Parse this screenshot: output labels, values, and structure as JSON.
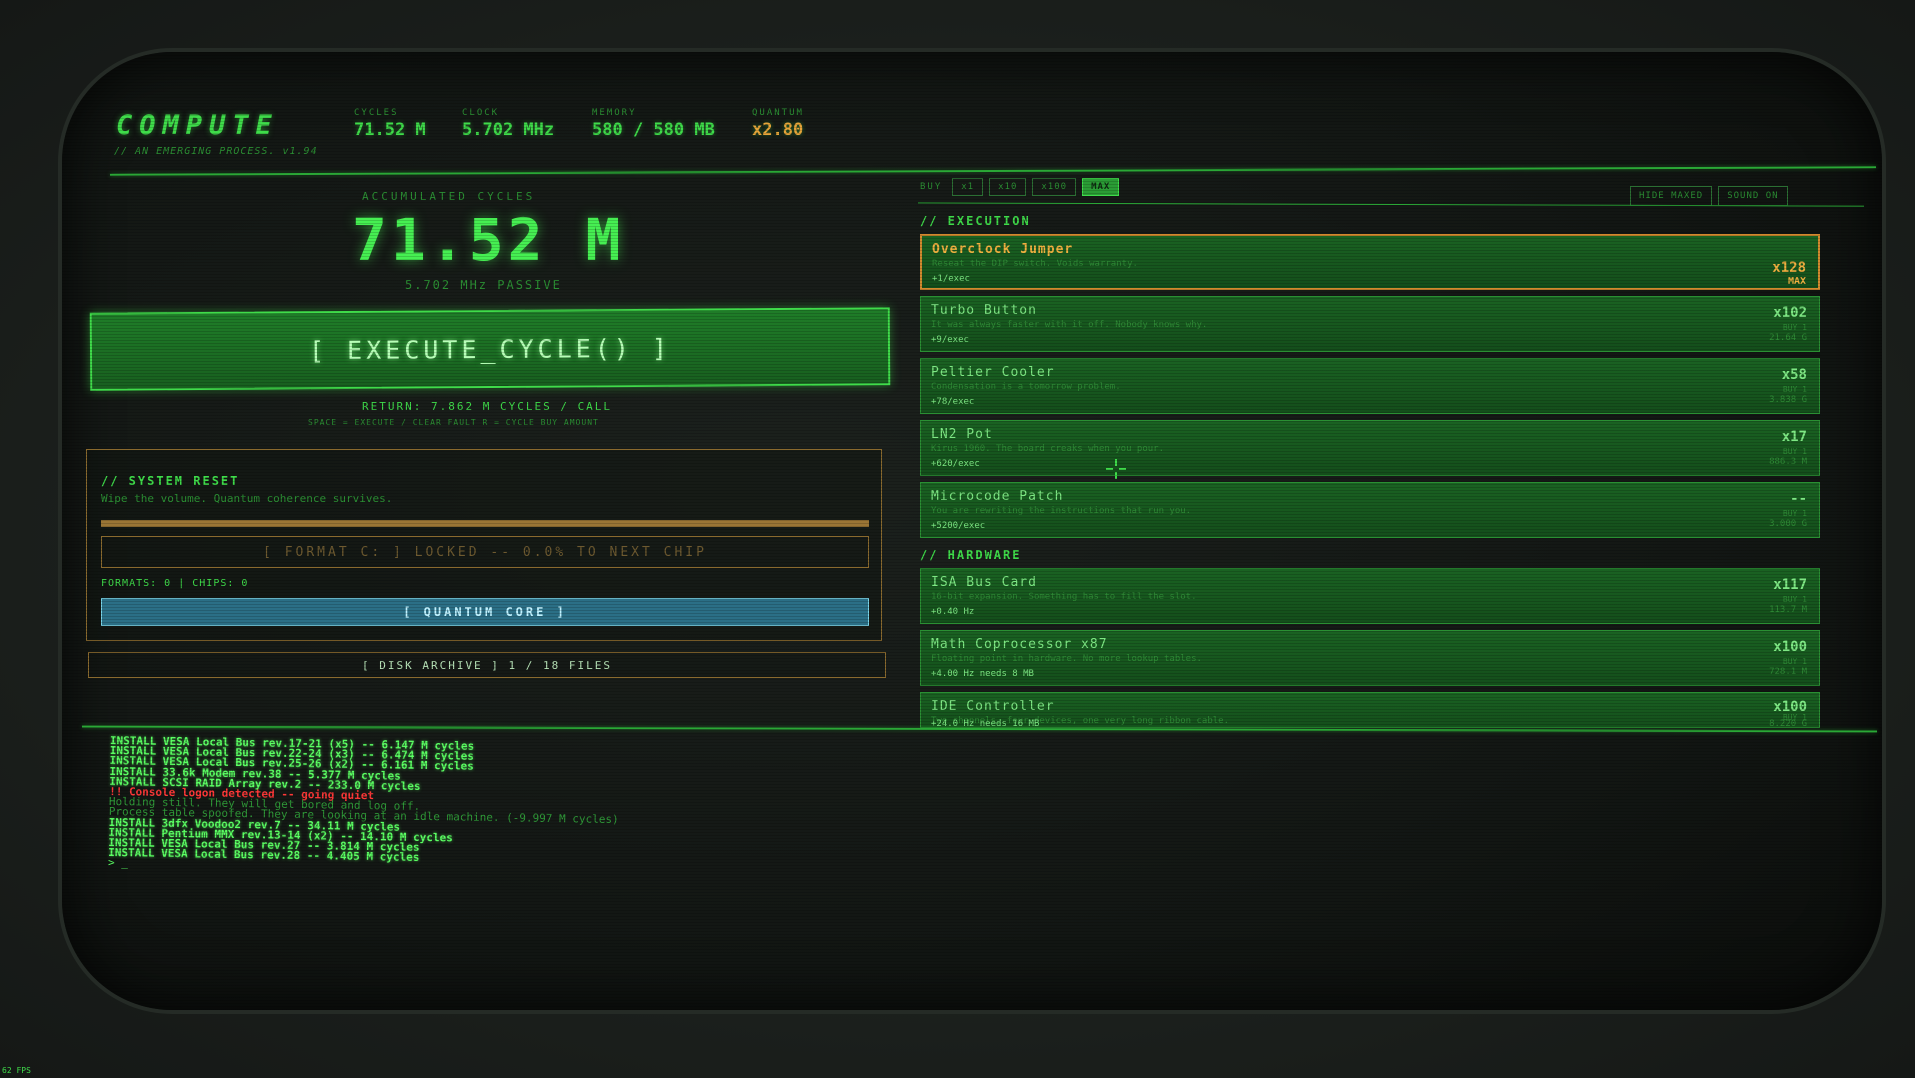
{
  "header": {
    "logo": "COMPUTE",
    "subtitle": "// AN EMERGING PROCESS. v1.94",
    "stats": [
      {
        "label": "CYCLES",
        "value": "71.52 M"
      },
      {
        "label": "CLOCK",
        "value": "5.702 MHz"
      },
      {
        "label": "MEMORY",
        "value": "580 / 580 MB"
      },
      {
        "label": "QUANTUM",
        "value": "x2.80"
      }
    ]
  },
  "main": {
    "accumulated_label": "ACCUMULATED CYCLES",
    "accumulated_value": "71.52 M",
    "passive": "5.702 MHz PASSIVE",
    "execute_button": "[ EXECUTE_CYCLE() ]",
    "return_line": "RETURN: 7.862 M CYCLES / CALL",
    "hotkeys": "SPACE = EXECUTE / CLEAR FAULT R = CYCLE BUY AMOUNT"
  },
  "reset": {
    "title": "// SYSTEM RESET",
    "desc": "Wipe the volume. Quantum coherence survives.",
    "progress": 1.0,
    "format_button": "[ FORMAT C: ] LOCKED -- 0.0% TO NEXT CHIP",
    "formats": "FORMATS: 0 | CHIPS: 0",
    "quantum_button": "[ QUANTUM CORE ]"
  },
  "archive": {
    "button": "[ DISK ARCHIVE ] 1 / 18 FILES"
  },
  "buy": {
    "label": "BUY",
    "options": [
      "x1",
      "x10",
      "x100",
      "MAX"
    ],
    "active": "MAX",
    "hide_maxed": "HIDE MAXED",
    "sound": "SOUND ON"
  },
  "execution": {
    "title": "// EXECUTION",
    "items": [
      {
        "name": "Overclock Jumper",
        "desc": "Reseat the DIP switch. Voids warranty.",
        "rate": "+1/exec",
        "count": "x128",
        "buy": "",
        "cost": "",
        "max": "MAX"
      },
      {
        "name": "Turbo Button",
        "desc": "It was always faster with it off. Nobody knows why.",
        "rate": "+9/exec",
        "count": "x102",
        "buy": "BUY 1",
        "cost": "21.64 G",
        "max": ""
      },
      {
        "name": "Peltier Cooler",
        "desc": "Condensation is a tomorrow problem.",
        "rate": "+78/exec",
        "count": "x58",
        "buy": "BUY 1",
        "cost": "3.838 G",
        "max": ""
      },
      {
        "name": "LN2 Pot",
        "desc": "Kirus 1960. The board creaks when you pour.",
        "rate": "+620/exec",
        "count": "x17",
        "buy": "BUY 1",
        "cost": "886.3 M",
        "max": ""
      },
      {
        "name": "Microcode Patch",
        "desc": "You are rewriting the instructions that run you.",
        "rate": "+5200/exec",
        "count": "--",
        "buy": "BUY 1",
        "cost": "3.000 G",
        "max": ""
      }
    ]
  },
  "hardware": {
    "title": "// HARDWARE",
    "items": [
      {
        "name": "ISA Bus Card",
        "desc": "16-bit expansion. Something has to fill the slot.",
        "rate": "+0.40 Hz",
        "count": "x117",
        "buy": "BUY 1",
        "cost": "113.7 M"
      },
      {
        "name": "Math Coprocessor x87",
        "desc": "Floating point in hardware. No more lookup tables.",
        "rate": "+4.00 Hz needs 8 MB",
        "count": "x100",
        "buy": "BUY 1",
        "cost": "728.1 M"
      },
      {
        "name": "IDE Controller",
        "desc": "Two channels, four devices, one very long ribbon cable.",
        "rate": "+24.0 Hz needs 16 MB",
        "count": "x100",
        "buy": "BUY 1",
        "cost": "8.220 G"
      }
    ]
  },
  "console": {
    "lines": [
      {
        "type": "install",
        "text": "INSTALL VESA Local Bus rev.17-21 (x5) -- 6.147 M cycles"
      },
      {
        "type": "install",
        "text": "INSTALL VESA Local Bus rev.22-24 (x3) -- 6.474 M cycles"
      },
      {
        "type": "install",
        "text": "INSTALL VESA Local Bus rev.25-26 (x2) -- 6.161 M cycles"
      },
      {
        "type": "install",
        "text": "INSTALL 33.6k Modem rev.38 -- 5.377 M cycles"
      },
      {
        "type": "install",
        "text": "INSTALL SCSI RAID Array rev.2 -- 233.0 M cycles"
      },
      {
        "type": "alert",
        "text": "!! Console logon detected -- going quiet"
      },
      {
        "type": "dim",
        "text": "Holding still. They will get bored and log off."
      },
      {
        "type": "dim",
        "text": "Process table spoofed. They are looking at an idle machine. (-9.997 M cycles)"
      },
      {
        "type": "install",
        "text": "INSTALL 3dfx Voodoo2 rev.7 -- 34.11 M cycles"
      },
      {
        "type": "install",
        "text": "INSTALL Pentium MMX rev.13-14 (x2) -- 14.10 M cycles"
      },
      {
        "type": "install",
        "text": "INSTALL VESA Local Bus rev.27 -- 3.814 M cycles"
      },
      {
        "type": "install",
        "text": "INSTALL VESA Local Bus rev.28 -- 4.405 M cycles"
      },
      {
        "type": "dim",
        "text": "> _"
      }
    ]
  },
  "fps": "62 FPS",
  "colors": {
    "phosphor": "#3fdc4a",
    "dim": "#2b8f33",
    "amber": "#e6a53a",
    "alert": "#ff3838",
    "quantum": "#2b6f86"
  }
}
